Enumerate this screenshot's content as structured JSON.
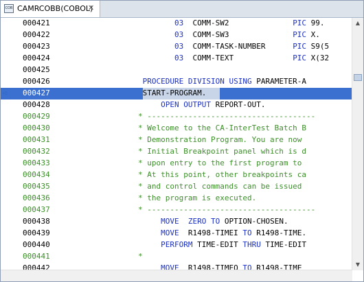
{
  "tab": {
    "icon": "cobol-file-icon",
    "icon_text": "COB",
    "title": "CAMRCOBB(COBOL)",
    "close": "✕"
  },
  "lines": [
    {
      "seq": "000421",
      "segments": [
        [
          "",
          "        "
        ],
        [
          "kw",
          "03"
        ],
        [
          "",
          "  COMM-SW2              "
        ],
        [
          "kw",
          "PIC"
        ],
        [
          "",
          " 99."
        ]
      ]
    },
    {
      "seq": "000422",
      "segments": [
        [
          "",
          "        "
        ],
        [
          "kw",
          "03"
        ],
        [
          "",
          "  COMM-SW3              "
        ],
        [
          "kw",
          "PIC"
        ],
        [
          "",
          " X."
        ]
      ]
    },
    {
      "seq": "000423",
      "segments": [
        [
          "",
          "        "
        ],
        [
          "kw",
          "03"
        ],
        [
          "",
          "  COMM-TASK-NUMBER      "
        ],
        [
          "kw",
          "PIC"
        ],
        [
          "",
          " S9(5"
        ]
      ]
    },
    {
      "seq": "000424",
      "segments": [
        [
          "",
          "        "
        ],
        [
          "kw",
          "03"
        ],
        [
          "",
          "  COMM-TEXT             "
        ],
        [
          "kw",
          "PIC"
        ],
        [
          "",
          " X(32"
        ]
      ]
    },
    {
      "seq": "000425",
      "segments": []
    },
    {
      "seq": "000426",
      "segments": [
        [
          "",
          " "
        ],
        [
          "kw",
          "PROCEDURE DIVISION USING"
        ],
        [
          "",
          " PARAMETER-A"
        ]
      ]
    },
    {
      "seq": "000427",
      "current": true,
      "segments": [
        [
          "",
          " START-PROGRAM."
        ]
      ]
    },
    {
      "seq": "000428",
      "segments": [
        [
          "",
          "     "
        ],
        [
          "kw",
          "OPEN OUTPUT"
        ],
        [
          "",
          " REPORT-OUT."
        ]
      ]
    },
    {
      "seq": "000429",
      "comment": true,
      "segments": [
        [
          "",
          "* -------------------------------------"
        ]
      ]
    },
    {
      "seq": "000430",
      "comment": true,
      "segments": [
        [
          "",
          "* Welcome to the CA-InterTest Batch B"
        ]
      ]
    },
    {
      "seq": "000431",
      "comment": true,
      "segments": [
        [
          "",
          "* Demonstration Program. You are now "
        ]
      ]
    },
    {
      "seq": "000432",
      "comment": true,
      "segments": [
        [
          "",
          "* Initial Breakpoint panel which is d"
        ]
      ]
    },
    {
      "seq": "000433",
      "comment": true,
      "segments": [
        [
          "",
          "* upon entry to the first program to "
        ]
      ]
    },
    {
      "seq": "000434",
      "comment": true,
      "segments": [
        [
          "",
          "* At this point, other breakpoints ca"
        ]
      ]
    },
    {
      "seq": "000435",
      "comment": true,
      "segments": [
        [
          "",
          "* and control commands can be issued "
        ]
      ]
    },
    {
      "seq": "000436",
      "comment": true,
      "segments": [
        [
          "",
          "* the program is executed."
        ]
      ]
    },
    {
      "seq": "000437",
      "comment": true,
      "segments": [
        [
          "",
          "* -------------------------------------"
        ]
      ]
    },
    {
      "seq": "000438",
      "segments": [
        [
          "",
          "     "
        ],
        [
          "kw",
          "MOVE"
        ],
        [
          "",
          "  "
        ],
        [
          "kw",
          "ZERO TO"
        ],
        [
          "",
          " OPTION-CHOSEN."
        ]
      ]
    },
    {
      "seq": "000439",
      "segments": [
        [
          "",
          "     "
        ],
        [
          "kw",
          "MOVE"
        ],
        [
          "",
          "  R1498-TIMEI "
        ],
        [
          "kw",
          "TO"
        ],
        [
          "",
          " R1498-TIME."
        ]
      ]
    },
    {
      "seq": "000440",
      "segments": [
        [
          "",
          "     "
        ],
        [
          "kw",
          "PERFORM"
        ],
        [
          "",
          " TIME-EDIT "
        ],
        [
          "kw",
          "THRU"
        ],
        [
          "",
          " TIME-EDIT"
        ]
      ]
    },
    {
      "seq": "000441",
      "comment": true,
      "segments": [
        [
          "",
          "*"
        ]
      ]
    },
    {
      "seq": "000442",
      "segments": [
        [
          "",
          "     "
        ],
        [
          "kw",
          "MOVE"
        ],
        [
          "",
          "  R1498-TIMEO "
        ],
        [
          "kw",
          "TO"
        ],
        [
          "",
          " R1498-TIME"
        ]
      ]
    }
  ],
  "current_line_marker": "➪",
  "scroll": {
    "up": "▲",
    "down": "▼"
  }
}
